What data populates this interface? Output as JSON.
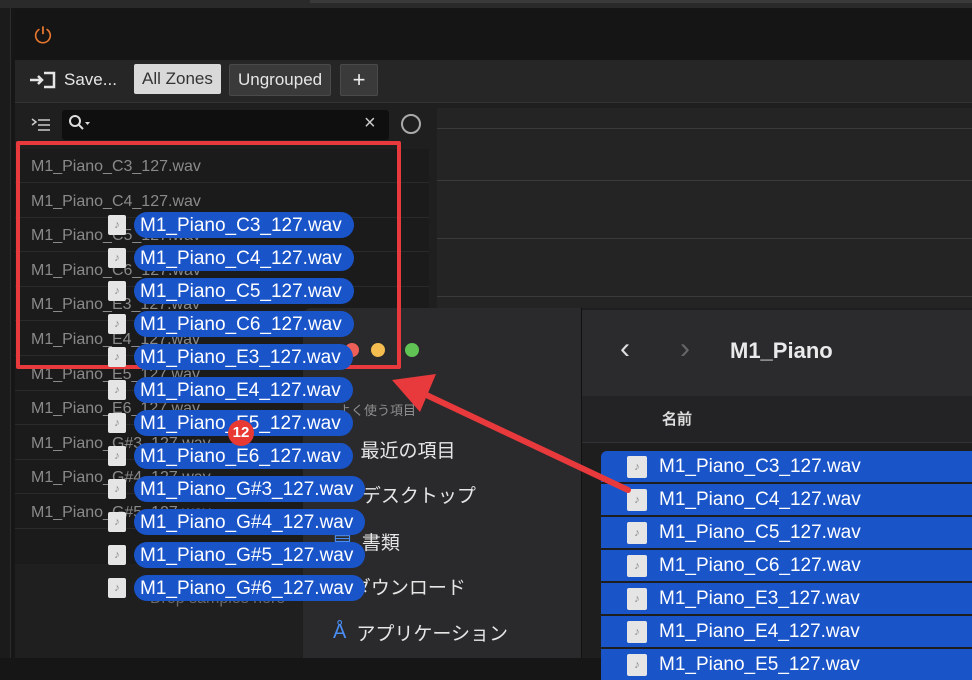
{
  "toolbar": {
    "save_label": "Save...",
    "chip_all_zones": "All Zones",
    "chip_ungrouped": "Ungrouped",
    "chip_add": "+"
  },
  "search": {
    "clear_glyph": "×"
  },
  "file_list": {
    "items": [
      "M1_Piano_C3_127.wav",
      "M1_Piano_C4_127.wav",
      "M1_Piano_C5_127.wav",
      "M1_Piano_C6_127.wav",
      "M1_Piano_E3_127.wav",
      "M1_Piano_E4_127.wav",
      "M1_Piano_E5_127.wav",
      "M1_Piano_E6_127.wav",
      "M1_Piano_G#3_127.wav",
      "M1_Piano_G#4_127.wav",
      "M1_Piano_G#5_127.wav"
    ],
    "drop_hint": "Drop samples here"
  },
  "drag": {
    "count_badge": "12",
    "items": [
      "M1_Piano_C3_127.wav",
      "M1_Piano_C4_127.wav",
      "M1_Piano_C5_127.wav",
      "M1_Piano_C6_127.wav",
      "M1_Piano_E3_127.wav",
      "M1_Piano_E4_127.wav",
      "M1_Piano_E5_127.wav",
      "M1_Piano_E6_127.wav",
      "M1_Piano_G#3_127.wav",
      "M1_Piano_G#4_127.wav",
      "M1_Piano_G#5_127.wav",
      "M1_Piano_G#6_127.wav"
    ]
  },
  "finder": {
    "title": "M1_Piano",
    "column_name": "名前",
    "sidebar_section": "よく使う項目",
    "sidebar": [
      {
        "label": "最近の項目",
        "icon": "clock-icon"
      },
      {
        "label": "デスクトップ",
        "icon": "desktop-icon"
      },
      {
        "label": "書類",
        "icon": "document-icon"
      },
      {
        "label": "ダウンロード",
        "icon": "download-icon"
      },
      {
        "label": "アプリケーション",
        "icon": "applications-icon"
      }
    ],
    "files": [
      "M1_Piano_C3_127.wav",
      "M1_Piano_C4_127.wav",
      "M1_Piano_C5_127.wav",
      "M1_Piano_C6_127.wav",
      "M1_Piano_E3_127.wav",
      "M1_Piano_E4_127.wav",
      "M1_Piano_E5_127.wav"
    ]
  },
  "colors": {
    "accent_orange": "#e8772e",
    "selection_blue": "#1a54c9",
    "highlight_red": "#e8393c"
  }
}
